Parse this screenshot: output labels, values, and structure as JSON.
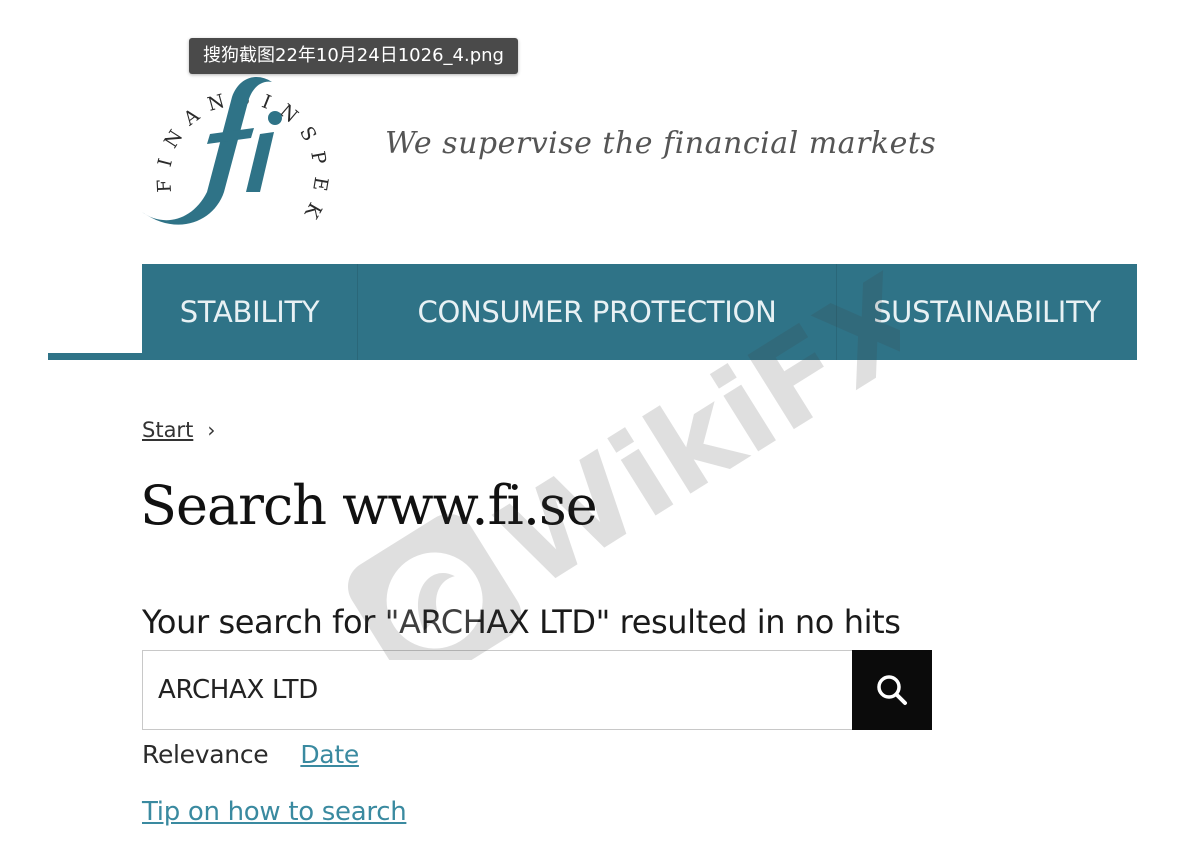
{
  "tooltip": {
    "filename": "搜狗截图22年10月24日1026_4.png"
  },
  "header": {
    "logo_letters": "fi",
    "logo_ring_text": "FINANSINSPEKTIONEN",
    "tagline": "We supervise the financial markets"
  },
  "nav": {
    "items": [
      {
        "label": "STABILITY"
      },
      {
        "label": "CONSUMER PROTECTION"
      },
      {
        "label": "SUSTAINABILITY"
      }
    ]
  },
  "breadcrumb": {
    "start": "Start",
    "separator": "›"
  },
  "main": {
    "title": "Search www.fi.se",
    "result_message": "Your search for \"ARCHAX LTD\" resulted in no hits",
    "search_value": "ARCHAX LTD",
    "sort_relevance": "Relevance",
    "sort_date": "Date",
    "tip_link": "Tip on how to search"
  },
  "watermark": {
    "text": "WikiFX"
  },
  "colors": {
    "nav_bg": "#2f7387",
    "link": "#3a8aa0",
    "search_button": "#0b0b0b"
  }
}
